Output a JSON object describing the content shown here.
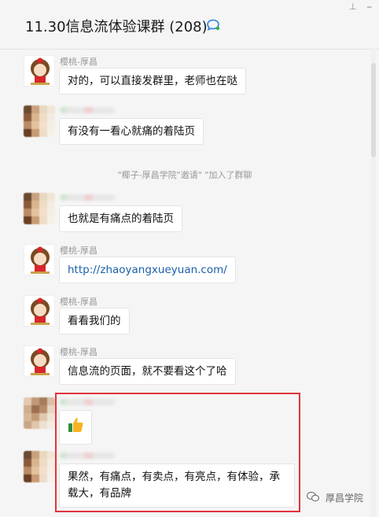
{
  "window": {
    "title": "11.30信息流体验课群 (208)"
  },
  "system_message": "\"椰子-厚昌学院\"邀请\"  \"加入了群聊",
  "messages": [
    {
      "sender": "樱桃-厚昌",
      "text": "对的，可以直接发群里，老师也在哒"
    },
    {
      "sender": "",
      "text": "有没有一看心就痛的着陆页"
    },
    {
      "sender": "",
      "text": "也就是有痛点的着陆页"
    },
    {
      "sender": "樱桃-厚昌",
      "text": "http://zhaoyangxueyuan.com/"
    },
    {
      "sender": "樱桃-厚昌",
      "text": "看看我们的"
    },
    {
      "sender": "樱桃-厚昌",
      "text": "信息流的页面，就不要看这个了哈"
    },
    {
      "sender": "",
      "text": "",
      "emoji": "thumbs-up-icon"
    },
    {
      "sender": "",
      "text": "果然，有痛点，有卖点，有亮点，有体验，承载大，有品牌"
    }
  ],
  "watermark": {
    "text": "厚昌学院",
    "icon": "wechat-official-icon"
  },
  "colors": {
    "highlight_border": "#e0353b",
    "link": "#1a5fa8",
    "background": "#f5f5f5"
  }
}
